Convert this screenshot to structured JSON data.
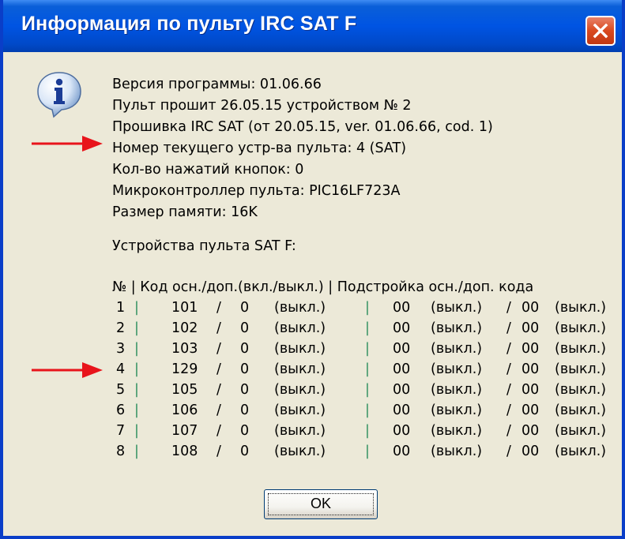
{
  "window": {
    "title": "Информация по пульту IRC SAT F",
    "accent_color": "#0054e3",
    "close_icon": "close-icon"
  },
  "info": {
    "icon": "info-icon",
    "lines": [
      "Версия программы: 01.06.66",
      "Пульт прошит 26.05.15 устройством № 2",
      "Прошивка IRC SAT (от 20.05.15, ver. 01.06.66, cod. 1)",
      "Номер текущего устр-ва пульта: 4 (SAT)",
      "Кол-во нажатий кнопок: 0",
      "Микроконтроллер пульта: PIC16LF723A",
      "Размер памяти: 16K"
    ]
  },
  "devices": {
    "heading": "Устройства пульта SAT F:",
    "header": "№ | Код осн./доп.(вкл./выкл.) | Подстройка осн./доп. кода",
    "rows": [
      {
        "n": "1",
        "code": "101",
        "add": "0",
        "state": "(выкл.)",
        "tune": "00",
        "tune_state": "(выкл.)",
        "tune_add": "00",
        "tune_add_state": "(выкл.)"
      },
      {
        "n": "2",
        "code": "102",
        "add": "0",
        "state": "(выкл.)",
        "tune": "00",
        "tune_state": "(выкл.)",
        "tune_add": "00",
        "tune_add_state": "(выкл.)"
      },
      {
        "n": "3",
        "code": "103",
        "add": "0",
        "state": "(выкл.)",
        "tune": "00",
        "tune_state": "(выкл.)",
        "tune_add": "00",
        "tune_add_state": "(выкл.)"
      },
      {
        "n": "4",
        "code": "129",
        "add": "0",
        "state": "(выкл.)",
        "tune": "00",
        "tune_state": "(выкл.)",
        "tune_add": "00",
        "tune_add_state": "(выкл.)"
      },
      {
        "n": "5",
        "code": "105",
        "add": "0",
        "state": "(выкл.)",
        "tune": "00",
        "tune_state": "(выкл.)",
        "tune_add": "00",
        "tune_add_state": "(выкл.)"
      },
      {
        "n": "6",
        "code": "106",
        "add": "0",
        "state": "(выкл.)",
        "tune": "00",
        "tune_state": "(выкл.)",
        "tune_add": "00",
        "tune_add_state": "(выкл.)"
      },
      {
        "n": "7",
        "code": "107",
        "add": "0",
        "state": "(выкл.)",
        "tune": "00",
        "tune_state": "(выкл.)",
        "tune_add": "00",
        "tune_add_state": "(выкл.)"
      },
      {
        "n": "8",
        "code": "108",
        "add": "0",
        "state": "(выкл.)",
        "tune": "00",
        "tune_state": "(выкл.)",
        "tune_add": "00",
        "tune_add_state": "(выкл.)"
      }
    ]
  },
  "annotations": {
    "arrow_color": "#e8141b",
    "arrow_icon": "red-arrow-icon"
  },
  "buttons": {
    "ok_label": "OK"
  }
}
